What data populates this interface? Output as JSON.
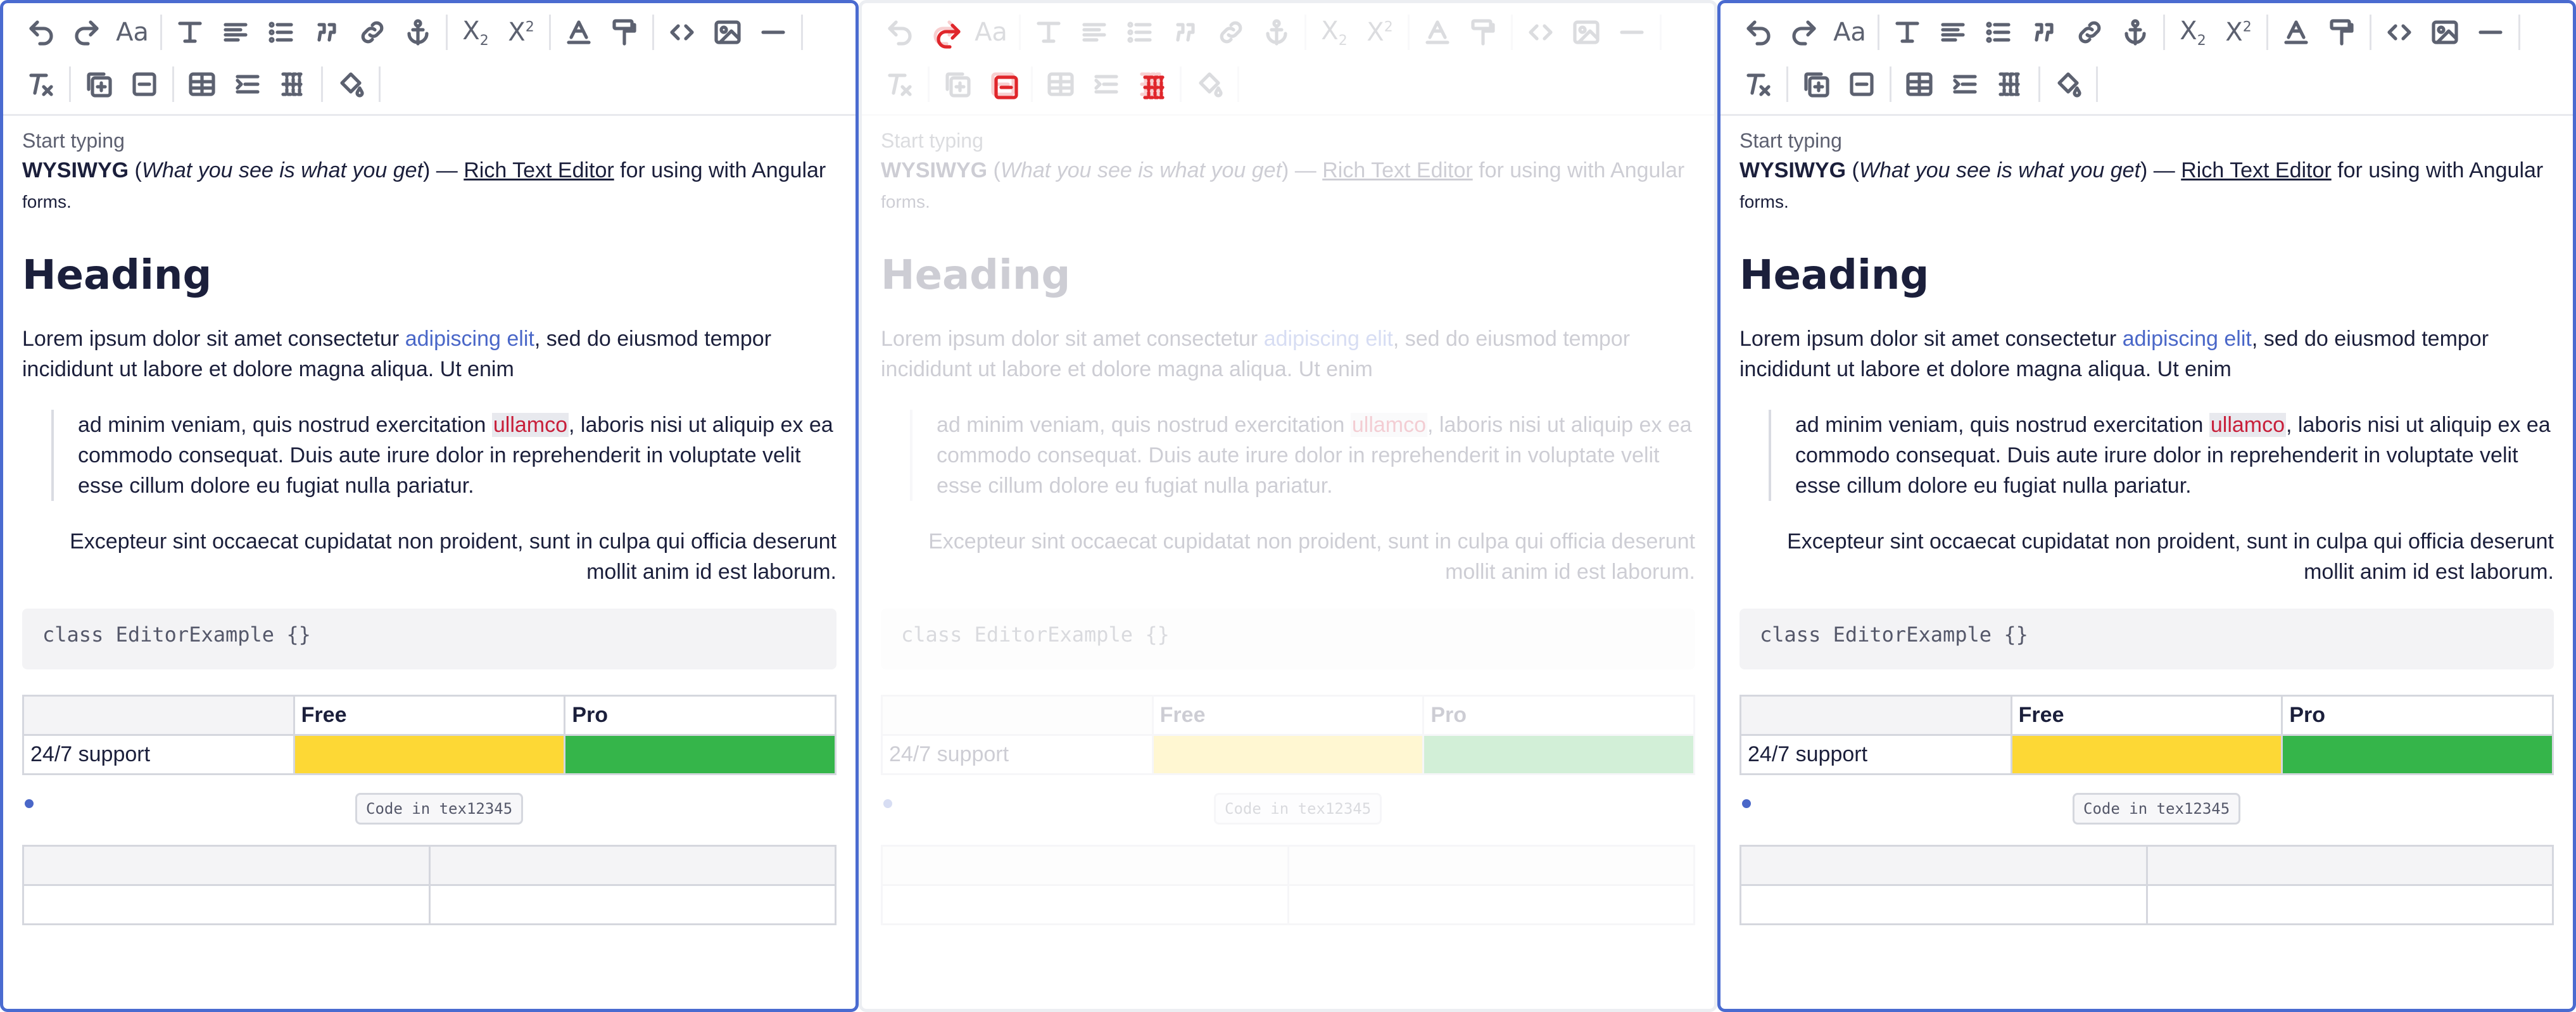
{
  "toolbar": {
    "row1": [
      "undo-icon",
      "redo-icon",
      "font-size-icon",
      "sep",
      "text-style-icon",
      "align-icon",
      "list-icon",
      "blockquote-icon",
      "link-icon",
      "anchor-icon",
      "sep",
      "subscript-icon",
      "superscript-icon",
      "sep",
      "text-color-icon",
      "format-painter-icon",
      "sep",
      "code-icon",
      "image-icon",
      "horizontal-rule-icon",
      "sep"
    ],
    "row2": [
      "clear-format-icon",
      "sep",
      "insert-column-icon",
      "delete-column-icon",
      "sep",
      "table-icon",
      "merge-icon",
      "split-icon",
      "sep",
      "fill-color-icon",
      "sep"
    ]
  },
  "editor": {
    "placeholder": "Start typing",
    "intro_bold": "WYSIWYG",
    "intro_paren_open": " (",
    "intro_italic": "What you see is what you get",
    "intro_mid": ") — ",
    "intro_link": "Rich Text Editor",
    "intro_end": " for using with Angular",
    "intro_small": "forms.",
    "heading": "Heading",
    "p1_a": "Lorem ipsum dolor sit amet consectetur ",
    "p1_link": "adipiscing elit",
    "p1_b": ", sed do eiusmod tempor incididunt ut labore et dolore magna aliqua. Ut enim",
    "quote_a": "ad minim veniam, quis nostrud exercitation ",
    "quote_mark": "ullamco",
    "quote_b": ", laboris nisi ut aliquip ex ea commodo consequat. Duis aute irure dolor in reprehenderit in voluptate velit esse cillum dolore eu fugiat nulla pariatur.",
    "right_para": "Excepteur sint occaecat cupidatat non proident, sunt in culpa qui officia deserunt mollit anim id est laborum.",
    "code_block": "class EditorExample {}",
    "table1": {
      "headers": [
        "",
        "Free",
        "Pro"
      ],
      "row": [
        "24/7 support",
        "",
        ""
      ]
    },
    "code_chip": "Code in tex12345"
  },
  "colors": {
    "accent": "#4a6bd0",
    "yellow": "#fdd835",
    "green": "#35b54a",
    "red": "#e0262b"
  }
}
